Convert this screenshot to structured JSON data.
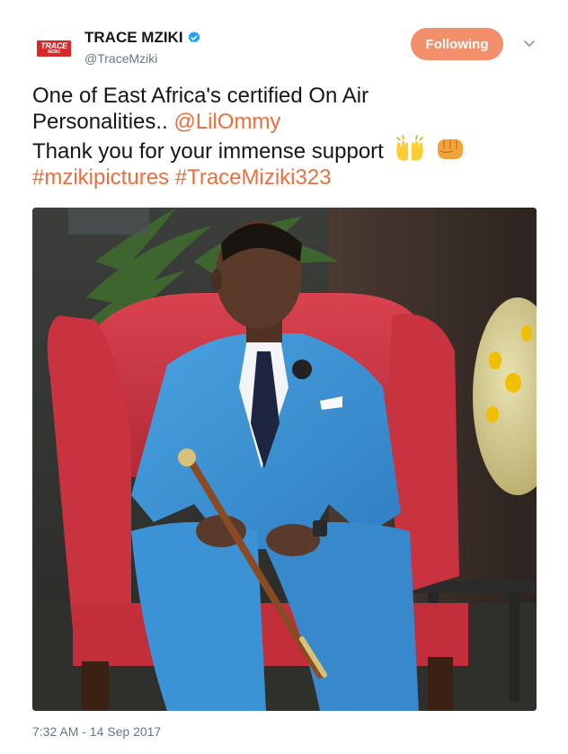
{
  "account": {
    "display_name": "TRACE MZIKI",
    "handle": "@TraceMziki",
    "logo_text": "TRACE",
    "logo_subtext": "MZIKI",
    "verified": true
  },
  "follow_button": {
    "label": "Following"
  },
  "tweet": {
    "line1": "One of East Africa's certified On Air",
    "line2_prefix": "Personalities.. ",
    "mention": "@LilOmmy",
    "line3": "Thank you for your immense support",
    "hashtag1": "#mzikipictures",
    "hashtag2": "#TraceMiziki323",
    "emojis": [
      "raising-hands-emoji",
      "fist-emoji"
    ]
  },
  "media": {
    "type": "photo"
  },
  "timestamp": "7:32 AM - 14 Sep 2017",
  "colors": {
    "link": "#e8703e",
    "follow_button_bg": "#f38f6b",
    "secondary_text": "#657786",
    "verified_badge": "#1da1f2",
    "logo_red": "#d42a2a"
  }
}
